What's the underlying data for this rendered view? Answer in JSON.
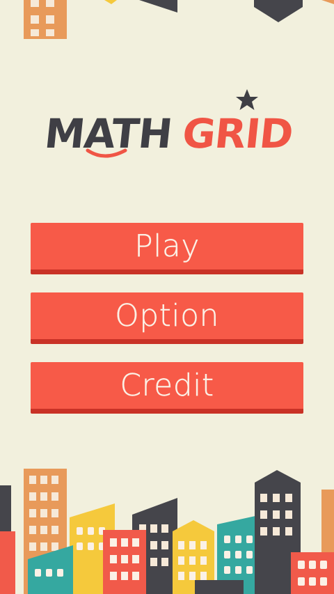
{
  "logo": {
    "word1": "MATH",
    "word2": "GRID"
  },
  "menu": {
    "play_label": "Play",
    "option_label": "Option",
    "credit_label": "Credit"
  },
  "colors": {
    "background": "#f2f0dd",
    "button": "#f75a48",
    "button_shadow": "#c93226",
    "button_text": "#fbf1e6",
    "logo_dark": "#3f3f45",
    "logo_accent": "#f05545",
    "building_orange": "#e89a5a",
    "building_yellow": "#f5c93c",
    "building_teal": "#35a8a0",
    "building_red": "#f15a4a",
    "building_dark": "#45454b"
  },
  "icons": [
    "star-icon",
    "smile-swoosh-icon"
  ]
}
